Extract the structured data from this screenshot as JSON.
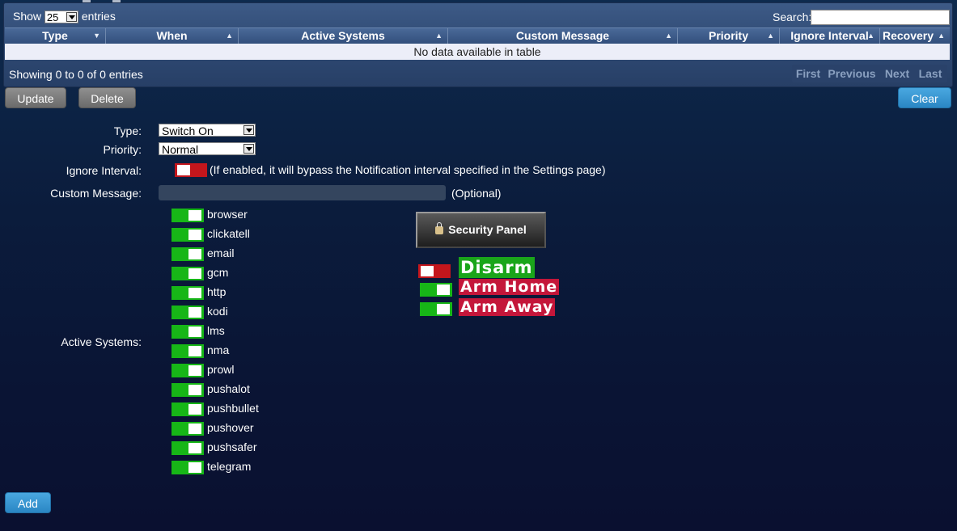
{
  "table": {
    "length": {
      "before": "Show",
      "value": "25",
      "after": "entries"
    },
    "search_label": "Search:",
    "columns": [
      "Type",
      "When",
      "Active Systems",
      "Custom Message",
      "Priority",
      "Ignore Interval",
      "Recovery"
    ],
    "empty_text": "No data available in table",
    "info": "Showing 0 to 0 of 0 entries",
    "pager": [
      "First",
      "Previous",
      "Next",
      "Last"
    ]
  },
  "actions": {
    "update": "Update",
    "delete": "Delete",
    "clear": "Clear",
    "add": "Add"
  },
  "form": {
    "type_label": "Type:",
    "type_value": "Switch On",
    "priority_label": "Priority:",
    "priority_value": "Normal",
    "ignore_label": "Ignore Interval:",
    "ignore_note": "(If enabled, it will bypass the Notification interval specified in the Settings page)",
    "ignore_state": "off",
    "custom_label": "Custom Message:",
    "custom_value": "",
    "custom_note": "(Optional)",
    "active_label": "Active Systems:",
    "systems": [
      "browser",
      "clickatell",
      "email",
      "gcm",
      "http",
      "kodi",
      "lms",
      "nma",
      "prowl",
      "pushalot",
      "pushbullet",
      "pushover",
      "pushsafer",
      "telegram"
    ]
  },
  "security": {
    "button": "Security Panel",
    "states": [
      {
        "label": "Disarm",
        "toggle": "off",
        "color": "#1aa51a"
      },
      {
        "label": "Arm Home",
        "toggle": "on",
        "color": "#c4163a"
      },
      {
        "label": "Arm Away",
        "toggle": "on",
        "color": "#c4163a"
      }
    ]
  }
}
